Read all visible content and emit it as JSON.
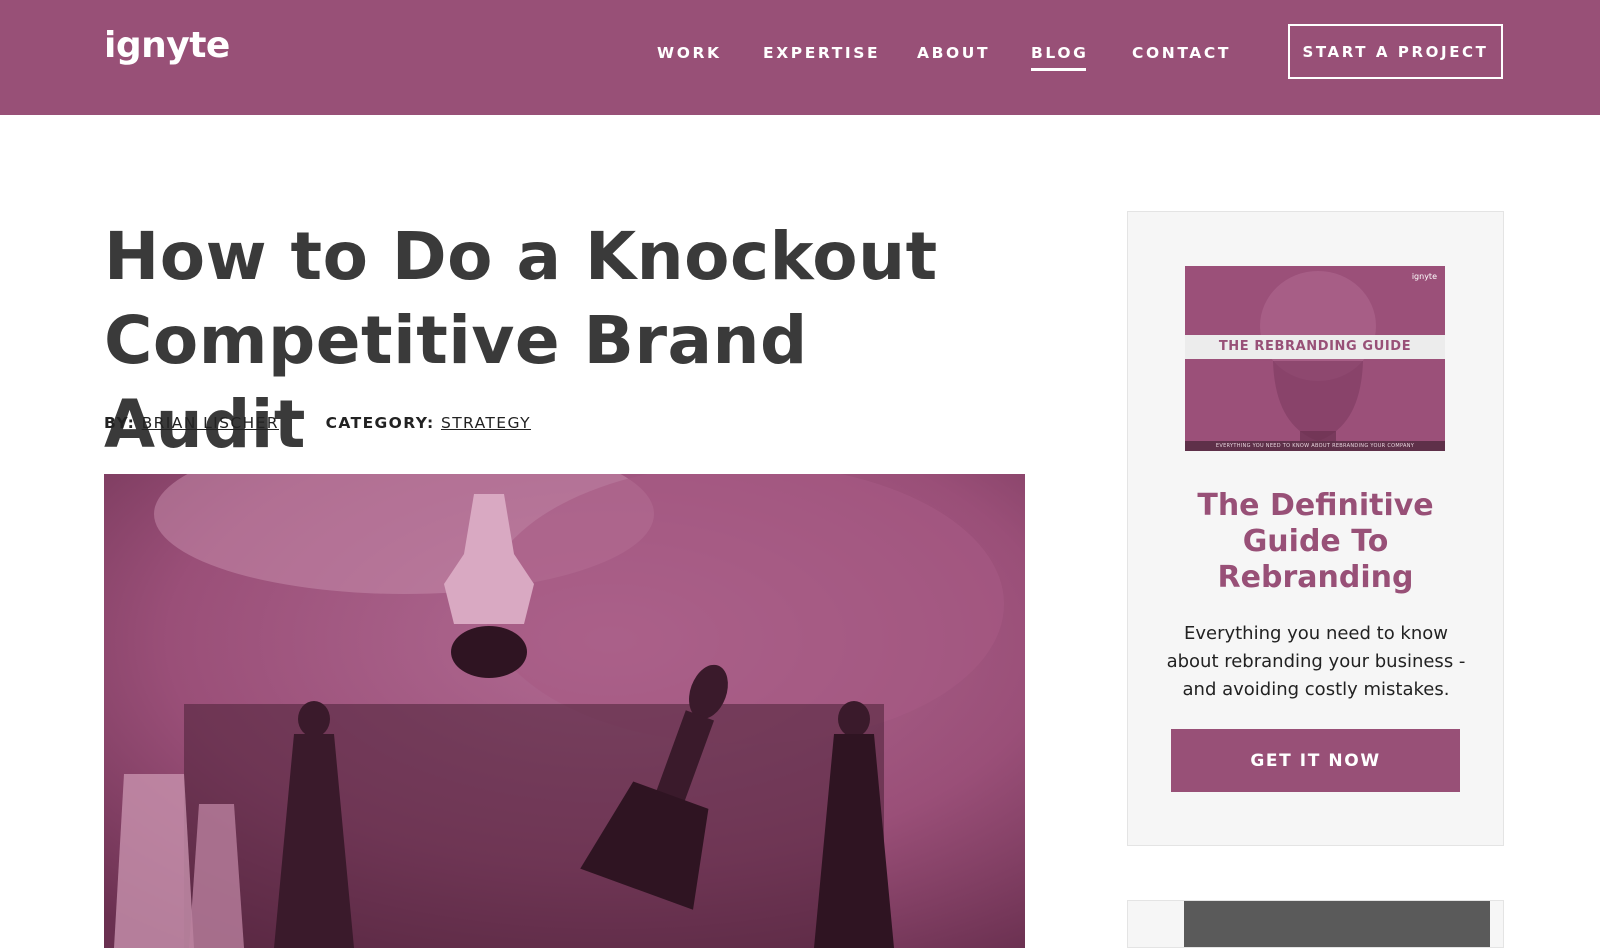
{
  "brand": {
    "logo": "ignyte",
    "color": "#985077"
  },
  "nav": {
    "items": [
      {
        "label": "WORK"
      },
      {
        "label": "EXPERTISE"
      },
      {
        "label": "ABOUT"
      },
      {
        "label": "BLOG",
        "active": true
      },
      {
        "label": "CONTACT"
      }
    ],
    "cta": "START A PROJECT"
  },
  "article": {
    "title_line1": "How to Do a Knockout",
    "title_line2": "Competitive Brand Audit",
    "by_label": "BY:",
    "author": "BRIAN LISCHER",
    "category_label": "CATEGORY:",
    "category": "STRATEGY"
  },
  "sidebar": {
    "cover": {
      "logo": "ignyte",
      "band_title": "THE REBRANDING GUIDE",
      "footer": "EVERYTHING YOU NEED TO KNOW ABOUT REBRANDING YOUR COMPANY"
    },
    "title": "The Definitive Guide To Rebranding",
    "text": "Everything you need to know about rebranding your business - and avoiding costly mistakes.",
    "button": "GET IT NOW"
  }
}
